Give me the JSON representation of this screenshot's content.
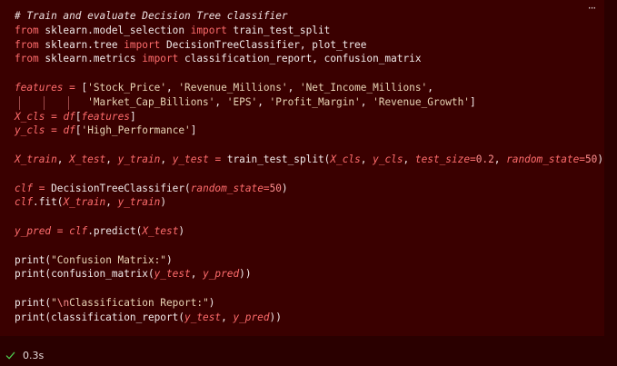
{
  "cell": {
    "more_label": "···",
    "code_lines": [
      [
        {
          "k": "comment",
          "t": "# Train and evaluate Decision Tree classifier"
        }
      ],
      [
        {
          "k": "keyword",
          "t": "from"
        },
        {
          "k": "plain",
          "t": " sklearn.model_selection "
        },
        {
          "k": "keyword",
          "t": "import"
        },
        {
          "k": "plain",
          "t": " train_test_split"
        }
      ],
      [
        {
          "k": "keyword",
          "t": "from"
        },
        {
          "k": "plain",
          "t": " sklearn.tree "
        },
        {
          "k": "keyword",
          "t": "import"
        },
        {
          "k": "plain",
          "t": " DecisionTreeClassifier, plot_tree"
        }
      ],
      [
        {
          "k": "keyword",
          "t": "from"
        },
        {
          "k": "plain",
          "t": " sklearn.metrics "
        },
        {
          "k": "keyword",
          "t": "import"
        },
        {
          "k": "plain",
          "t": " classification_report, confusion_matrix"
        }
      ],
      [],
      [
        {
          "k": "var",
          "t": "features"
        },
        {
          "k": "plain",
          "t": " "
        },
        {
          "k": "op",
          "t": "="
        },
        {
          "k": "plain",
          "t": " ["
        },
        {
          "k": "string",
          "t": "'Stock_Price'"
        },
        {
          "k": "plain",
          "t": ", "
        },
        {
          "k": "string",
          "t": "'Revenue_Millions'"
        },
        {
          "k": "plain",
          "t": ", "
        },
        {
          "k": "string",
          "t": "'Net_Income_Millions'"
        },
        {
          "k": "plain",
          "t": ","
        }
      ],
      [
        {
          "k": "plain",
          "t": "            "
        },
        {
          "k": "string",
          "t": "'Market_Cap_Billions'"
        },
        {
          "k": "plain",
          "t": ", "
        },
        {
          "k": "string",
          "t": "'EPS'"
        },
        {
          "k": "plain",
          "t": ", "
        },
        {
          "k": "string",
          "t": "'Profit_Margin'"
        },
        {
          "k": "plain",
          "t": ", "
        },
        {
          "k": "string",
          "t": "'Revenue_Growth'"
        },
        {
          "k": "plain",
          "t": "]"
        }
      ],
      [
        {
          "k": "var",
          "t": "X_cls"
        },
        {
          "k": "plain",
          "t": " "
        },
        {
          "k": "op",
          "t": "="
        },
        {
          "k": "plain",
          "t": " "
        },
        {
          "k": "var",
          "t": "df"
        },
        {
          "k": "plain",
          "t": "["
        },
        {
          "k": "var",
          "t": "features"
        },
        {
          "k": "plain",
          "t": "]"
        }
      ],
      [
        {
          "k": "var",
          "t": "y_cls"
        },
        {
          "k": "plain",
          "t": " "
        },
        {
          "k": "op",
          "t": "="
        },
        {
          "k": "plain",
          "t": " "
        },
        {
          "k": "var",
          "t": "df"
        },
        {
          "k": "plain",
          "t": "["
        },
        {
          "k": "string",
          "t": "'High_Performance'"
        },
        {
          "k": "plain",
          "t": "]"
        }
      ],
      [],
      [
        {
          "k": "var",
          "t": "X_train"
        },
        {
          "k": "plain",
          "t": ", "
        },
        {
          "k": "var",
          "t": "X_test"
        },
        {
          "k": "plain",
          "t": ", "
        },
        {
          "k": "var",
          "t": "y_train"
        },
        {
          "k": "plain",
          "t": ", "
        },
        {
          "k": "var",
          "t": "y_test"
        },
        {
          "k": "plain",
          "t": " "
        },
        {
          "k": "op",
          "t": "="
        },
        {
          "k": "plain",
          "t": " train_test_split("
        },
        {
          "k": "var",
          "t": "X_cls"
        },
        {
          "k": "plain",
          "t": ", "
        },
        {
          "k": "var",
          "t": "y_cls"
        },
        {
          "k": "plain",
          "t": ", "
        },
        {
          "k": "var",
          "t": "test_size"
        },
        {
          "k": "op",
          "t": "="
        },
        {
          "k": "number",
          "t": "0.2"
        },
        {
          "k": "plain",
          "t": ", "
        },
        {
          "k": "var",
          "t": "random_state"
        },
        {
          "k": "op",
          "t": "="
        },
        {
          "k": "number",
          "t": "50"
        },
        {
          "k": "plain",
          "t": ")"
        }
      ],
      [],
      [
        {
          "k": "var",
          "t": "clf"
        },
        {
          "k": "plain",
          "t": " "
        },
        {
          "k": "op",
          "t": "="
        },
        {
          "k": "plain",
          "t": " DecisionTreeClassifier("
        },
        {
          "k": "var",
          "t": "random_state"
        },
        {
          "k": "op",
          "t": "="
        },
        {
          "k": "number",
          "t": "50"
        },
        {
          "k": "plain",
          "t": ")"
        }
      ],
      [
        {
          "k": "var",
          "t": "clf"
        },
        {
          "k": "plain",
          "t": ".fit("
        },
        {
          "k": "var",
          "t": "X_train"
        },
        {
          "k": "plain",
          "t": ", "
        },
        {
          "k": "var",
          "t": "y_train"
        },
        {
          "k": "plain",
          "t": ")"
        }
      ],
      [],
      [
        {
          "k": "var",
          "t": "y_pred"
        },
        {
          "k": "plain",
          "t": " "
        },
        {
          "k": "op",
          "t": "="
        },
        {
          "k": "plain",
          "t": " "
        },
        {
          "k": "var",
          "t": "clf"
        },
        {
          "k": "plain",
          "t": ".predict("
        },
        {
          "k": "var",
          "t": "X_test"
        },
        {
          "k": "plain",
          "t": ")"
        }
      ],
      [],
      [
        {
          "k": "plain",
          "t": "print("
        },
        {
          "k": "string",
          "t": "\"Confusion Matrix:\""
        },
        {
          "k": "plain",
          "t": ")"
        }
      ],
      [
        {
          "k": "plain",
          "t": "print(confusion_matrix("
        },
        {
          "k": "var",
          "t": "y_test"
        },
        {
          "k": "plain",
          "t": ", "
        },
        {
          "k": "var",
          "t": "y_pred"
        },
        {
          "k": "plain",
          "t": "))"
        }
      ],
      [],
      [
        {
          "k": "plain",
          "t": "print("
        },
        {
          "k": "string",
          "t": "\""
        },
        {
          "k": "number",
          "t": "\\n"
        },
        {
          "k": "string",
          "t": "Classification Report:\""
        },
        {
          "k": "plain",
          "t": ")"
        }
      ],
      [
        {
          "k": "plain",
          "t": "print(classification_report("
        },
        {
          "k": "var",
          "t": "y_test"
        },
        {
          "k": "plain",
          "t": ", "
        },
        {
          "k": "var",
          "t": "y_pred"
        },
        {
          "k": "plain",
          "t": "))"
        }
      ]
    ]
  },
  "status": {
    "icon": "check-icon",
    "time": "0.3s",
    "color": "#4ec94e"
  },
  "theme": {
    "background": "#2a0000",
    "cell_background": "#3a0000",
    "keyword": "#ff6c6c",
    "string": "#e8d3b4"
  }
}
